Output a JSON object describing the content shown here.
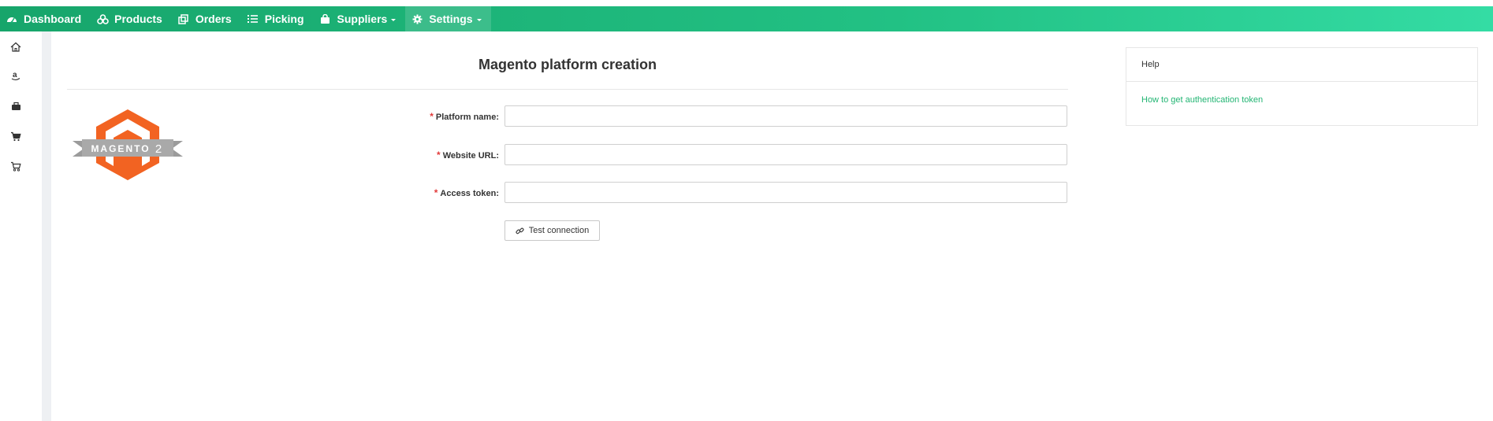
{
  "nav": {
    "items": [
      {
        "label": "Dashboard",
        "icon": "dashboard-gauge-icon",
        "has_dropdown": false
      },
      {
        "label": "Products",
        "icon": "cubes-icon",
        "has_dropdown": false
      },
      {
        "label": "Orders",
        "icon": "copy-documents-icon",
        "has_dropdown": false
      },
      {
        "label": "Picking",
        "icon": "list-icon",
        "has_dropdown": false
      },
      {
        "label": "Suppliers",
        "icon": "shopping-bag-icon",
        "has_dropdown": true
      },
      {
        "label": "Settings",
        "icon": "gear-icon",
        "has_dropdown": true
      }
    ],
    "active": "Settings"
  },
  "sidebar": {
    "icons": [
      "home-icon",
      "amazon-icon",
      "briefcase-icon",
      "cart-full-icon",
      "cart-outline-icon"
    ]
  },
  "page": {
    "title": "Magento platform creation",
    "logo_text": "MAGENTO",
    "logo_version": "2"
  },
  "form": {
    "fields": [
      {
        "label": "Platform name",
        "required": true,
        "value": "",
        "placeholder": ""
      },
      {
        "label": "Website URL",
        "required": true,
        "value": "",
        "placeholder": ""
      },
      {
        "label": "Access token",
        "required": true,
        "value": "",
        "placeholder": ""
      }
    ],
    "test_button_label": "Test connection"
  },
  "help": {
    "title": "Help",
    "link_label": "How to get authentication token"
  },
  "colors": {
    "brand_green": "#22c184",
    "link_green": "#22b573",
    "required_red": "#e23b3b",
    "magento_orange": "#f26322"
  }
}
